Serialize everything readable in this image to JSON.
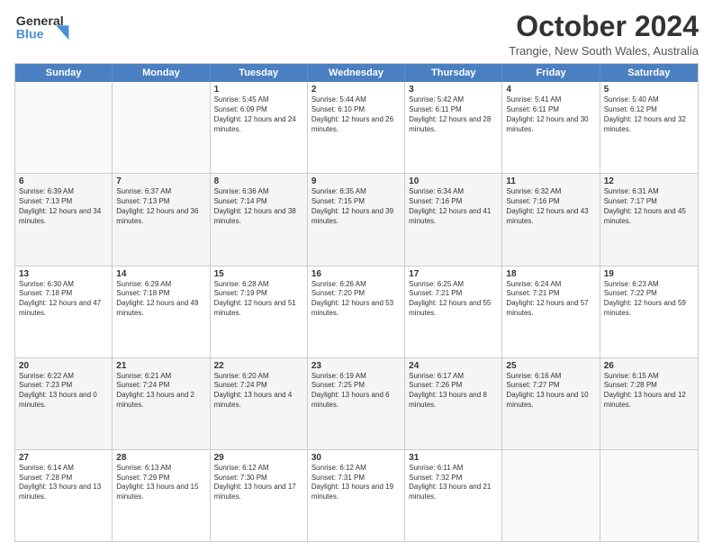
{
  "header": {
    "logo_general": "General",
    "logo_blue": "Blue",
    "month": "October 2024",
    "location": "Trangie, New South Wales, Australia"
  },
  "days_of_week": [
    "Sunday",
    "Monday",
    "Tuesday",
    "Wednesday",
    "Thursday",
    "Friday",
    "Saturday"
  ],
  "rows": [
    [
      {
        "day": "",
        "info": "",
        "empty": true
      },
      {
        "day": "",
        "info": "",
        "empty": true
      },
      {
        "day": "1",
        "info": "Sunrise: 5:45 AM\nSunset: 6:09 PM\nDaylight: 12 hours and 24 minutes."
      },
      {
        "day": "2",
        "info": "Sunrise: 5:44 AM\nSunset: 6:10 PM\nDaylight: 12 hours and 26 minutes."
      },
      {
        "day": "3",
        "info": "Sunrise: 5:42 AM\nSunset: 6:11 PM\nDaylight: 12 hours and 28 minutes."
      },
      {
        "day": "4",
        "info": "Sunrise: 5:41 AM\nSunset: 6:11 PM\nDaylight: 12 hours and 30 minutes."
      },
      {
        "day": "5",
        "info": "Sunrise: 5:40 AM\nSunset: 6:12 PM\nDaylight: 12 hours and 32 minutes."
      }
    ],
    [
      {
        "day": "6",
        "info": "Sunrise: 6:39 AM\nSunset: 7:13 PM\nDaylight: 12 hours and 34 minutes."
      },
      {
        "day": "7",
        "info": "Sunrise: 6:37 AM\nSunset: 7:13 PM\nDaylight: 12 hours and 36 minutes."
      },
      {
        "day": "8",
        "info": "Sunrise: 6:36 AM\nSunset: 7:14 PM\nDaylight: 12 hours and 38 minutes."
      },
      {
        "day": "9",
        "info": "Sunrise: 6:35 AM\nSunset: 7:15 PM\nDaylight: 12 hours and 39 minutes."
      },
      {
        "day": "10",
        "info": "Sunrise: 6:34 AM\nSunset: 7:16 PM\nDaylight: 12 hours and 41 minutes."
      },
      {
        "day": "11",
        "info": "Sunrise: 6:32 AM\nSunset: 7:16 PM\nDaylight: 12 hours and 43 minutes."
      },
      {
        "day": "12",
        "info": "Sunrise: 6:31 AM\nSunset: 7:17 PM\nDaylight: 12 hours and 45 minutes."
      }
    ],
    [
      {
        "day": "13",
        "info": "Sunrise: 6:30 AM\nSunset: 7:18 PM\nDaylight: 12 hours and 47 minutes."
      },
      {
        "day": "14",
        "info": "Sunrise: 6:29 AM\nSunset: 7:18 PM\nDaylight: 12 hours and 49 minutes."
      },
      {
        "day": "15",
        "info": "Sunrise: 6:28 AM\nSunset: 7:19 PM\nDaylight: 12 hours and 51 minutes."
      },
      {
        "day": "16",
        "info": "Sunrise: 6:26 AM\nSunset: 7:20 PM\nDaylight: 12 hours and 53 minutes."
      },
      {
        "day": "17",
        "info": "Sunrise: 6:25 AM\nSunset: 7:21 PM\nDaylight: 12 hours and 55 minutes."
      },
      {
        "day": "18",
        "info": "Sunrise: 6:24 AM\nSunset: 7:21 PM\nDaylight: 12 hours and 57 minutes."
      },
      {
        "day": "19",
        "info": "Sunrise: 6:23 AM\nSunset: 7:22 PM\nDaylight: 12 hours and 59 minutes."
      }
    ],
    [
      {
        "day": "20",
        "info": "Sunrise: 6:22 AM\nSunset: 7:23 PM\nDaylight: 13 hours and 0 minutes."
      },
      {
        "day": "21",
        "info": "Sunrise: 6:21 AM\nSunset: 7:24 PM\nDaylight: 13 hours and 2 minutes."
      },
      {
        "day": "22",
        "info": "Sunrise: 6:20 AM\nSunset: 7:24 PM\nDaylight: 13 hours and 4 minutes."
      },
      {
        "day": "23",
        "info": "Sunrise: 6:19 AM\nSunset: 7:25 PM\nDaylight: 13 hours and 6 minutes."
      },
      {
        "day": "24",
        "info": "Sunrise: 6:17 AM\nSunset: 7:26 PM\nDaylight: 13 hours and 8 minutes."
      },
      {
        "day": "25",
        "info": "Sunrise: 6:16 AM\nSunset: 7:27 PM\nDaylight: 13 hours and 10 minutes."
      },
      {
        "day": "26",
        "info": "Sunrise: 6:15 AM\nSunset: 7:28 PM\nDaylight: 13 hours and 12 minutes."
      }
    ],
    [
      {
        "day": "27",
        "info": "Sunrise: 6:14 AM\nSunset: 7:28 PM\nDaylight: 13 hours and 13 minutes."
      },
      {
        "day": "28",
        "info": "Sunrise: 6:13 AM\nSunset: 7:29 PM\nDaylight: 13 hours and 15 minutes."
      },
      {
        "day": "29",
        "info": "Sunrise: 6:12 AM\nSunset: 7:30 PM\nDaylight: 13 hours and 17 minutes."
      },
      {
        "day": "30",
        "info": "Sunrise: 6:12 AM\nSunset: 7:31 PM\nDaylight: 13 hours and 19 minutes."
      },
      {
        "day": "31",
        "info": "Sunrise: 6:11 AM\nSunset: 7:32 PM\nDaylight: 13 hours and 21 minutes."
      },
      {
        "day": "",
        "info": "",
        "empty": true
      },
      {
        "day": "",
        "info": "",
        "empty": true
      }
    ]
  ]
}
